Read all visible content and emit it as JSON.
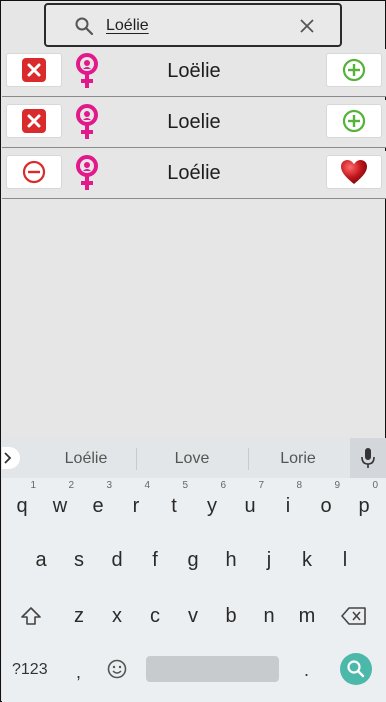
{
  "search": {
    "query": "Loélie"
  },
  "results": [
    {
      "left_action": "remove",
      "gender": "female",
      "name": "Loëlie",
      "right_action": "add"
    },
    {
      "left_action": "remove",
      "gender": "female",
      "name": "Loelie",
      "right_action": "add"
    },
    {
      "left_action": "neutral",
      "gender": "female",
      "name": "Loélie",
      "right_action": "favorite"
    }
  ],
  "keyboard": {
    "suggestions": [
      "Loélie",
      "Love",
      "Lorie"
    ],
    "row1": [
      {
        "k": "q",
        "n": "1"
      },
      {
        "k": "w",
        "n": "2"
      },
      {
        "k": "e",
        "n": "3"
      },
      {
        "k": "r",
        "n": "4"
      },
      {
        "k": "t",
        "n": "5"
      },
      {
        "k": "y",
        "n": "6"
      },
      {
        "k": "u",
        "n": "7"
      },
      {
        "k": "i",
        "n": "8"
      },
      {
        "k": "o",
        "n": "9"
      },
      {
        "k": "p",
        "n": "0"
      }
    ],
    "row2": [
      "a",
      "s",
      "d",
      "f",
      "g",
      "h",
      "j",
      "k",
      "l"
    ],
    "row3": [
      "z",
      "x",
      "c",
      "v",
      "b",
      "n",
      "m"
    ],
    "symbols_label": "?123",
    "comma": ",",
    "period": "."
  },
  "colors": {
    "female_pink": "#e2198b",
    "remove_red": "#d92b2b",
    "add_green": "#55b23a",
    "heart_red": "#c3161c",
    "search_key": "#4bb8a9"
  }
}
